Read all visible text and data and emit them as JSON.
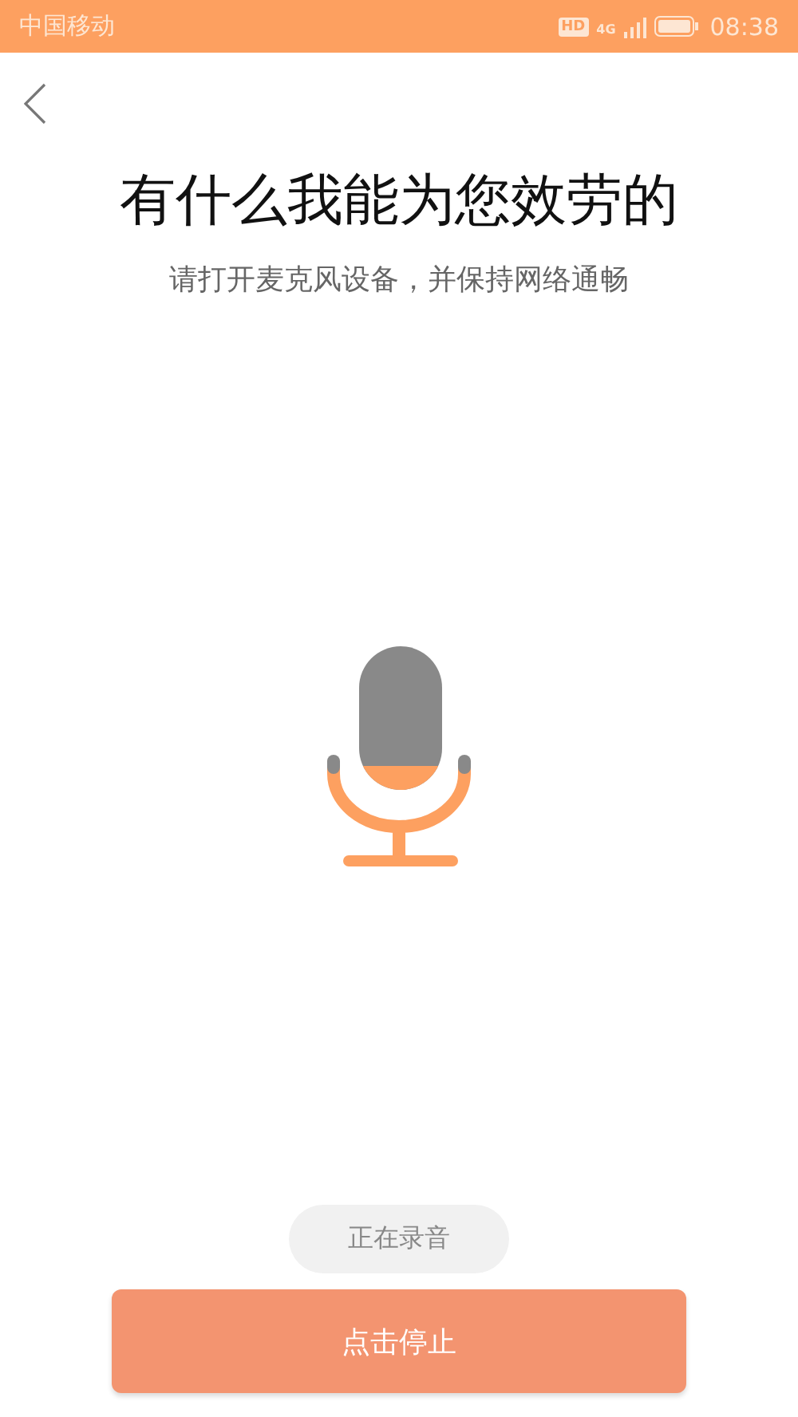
{
  "status_bar": {
    "carrier": "中国移动",
    "hd_badge": "HD",
    "network": "4G",
    "time": "08:38"
  },
  "title": "有什么我能为您效劳的",
  "subtitle": "请打开麦克风设备，并保持网络通畅",
  "status_label": "正在录音",
  "stop_button": "点击停止"
}
